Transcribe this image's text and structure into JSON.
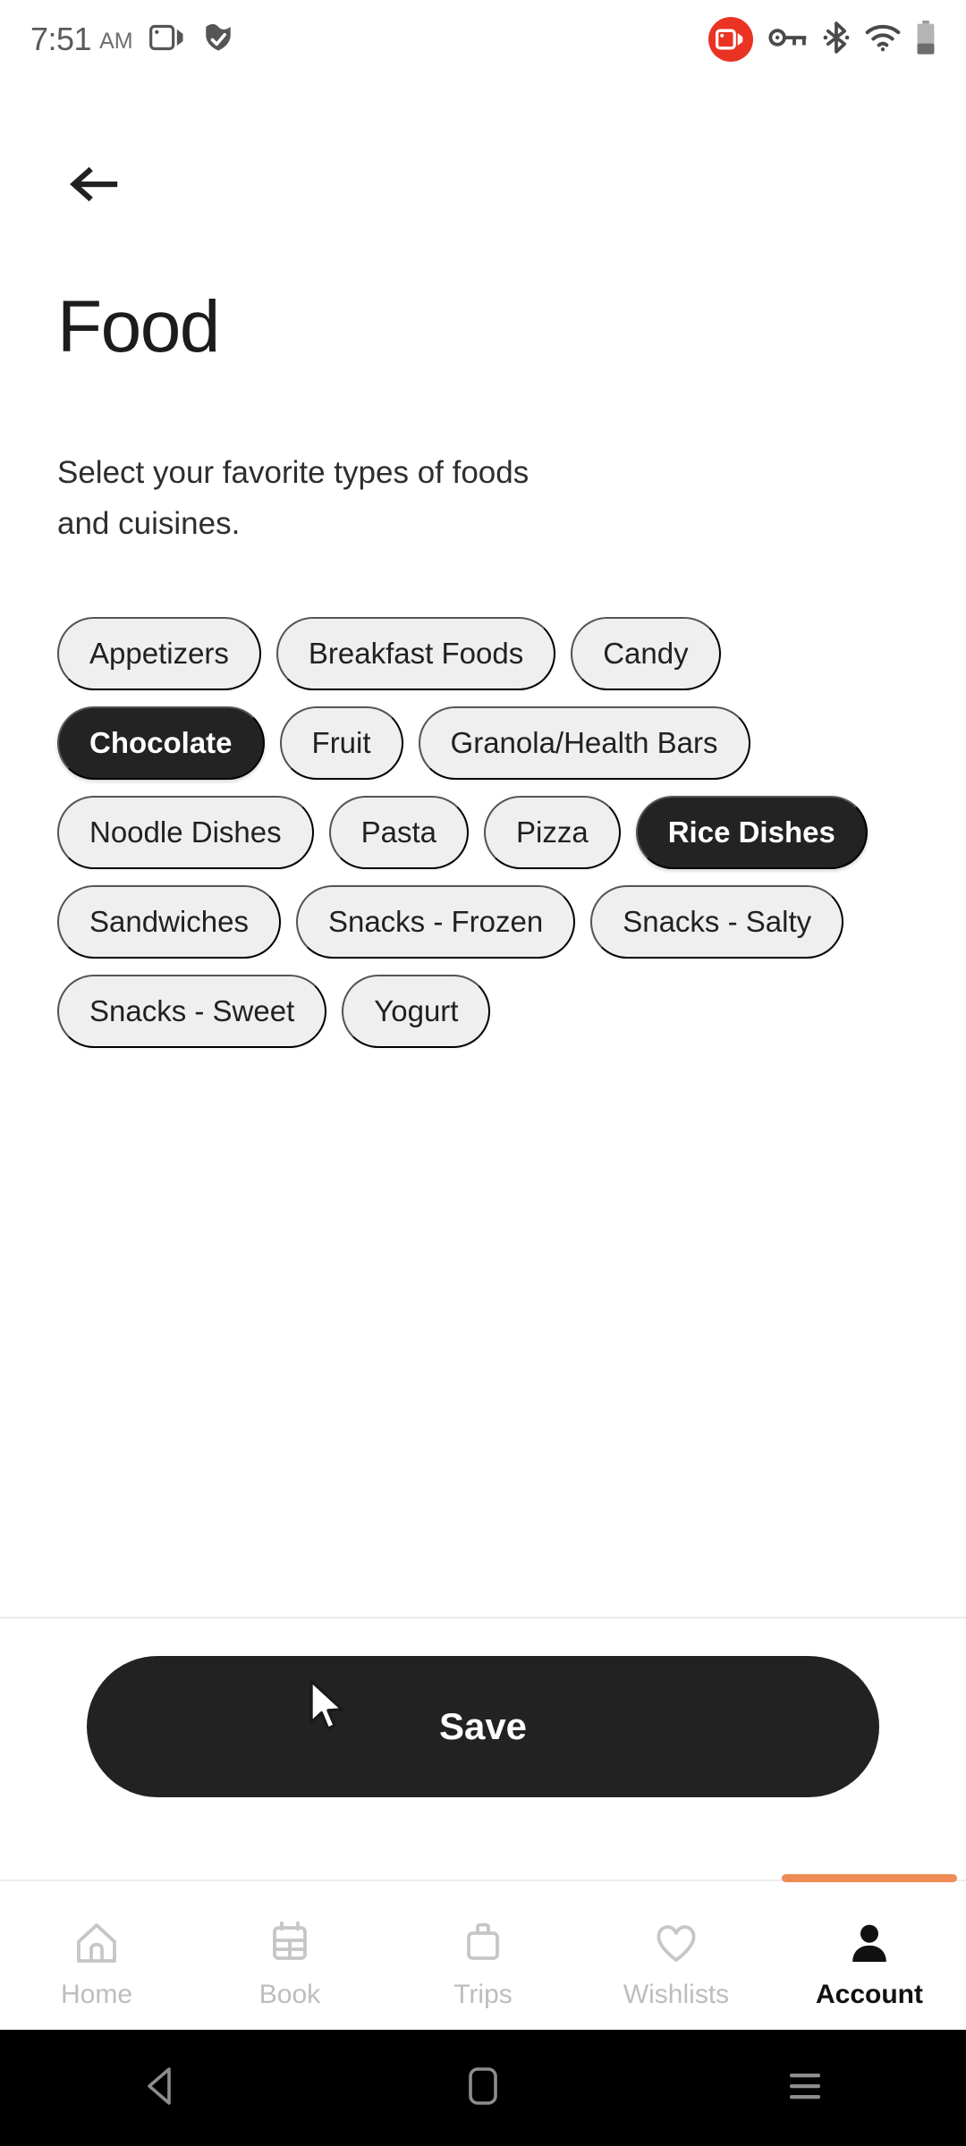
{
  "status_bar": {
    "time": "7:51",
    "ampm": "AM",
    "left_icons": [
      "screen-cast-icon",
      "vpn-shield-check-icon"
    ],
    "right_icons": [
      "screen-record-icon",
      "vpn-key-icon",
      "bluetooth-icon",
      "wifi-icon",
      "battery-icon"
    ],
    "record_badge_color": "#ea3323"
  },
  "header": {
    "back_label": "Back",
    "title": "Food",
    "description": "Select your favorite types of foods and cuisines."
  },
  "chips": [
    {
      "label": "Appetizers",
      "selected": false
    },
    {
      "label": "Breakfast Foods",
      "selected": false
    },
    {
      "label": "Candy",
      "selected": false
    },
    {
      "label": "Chocolate",
      "selected": true
    },
    {
      "label": "Fruit",
      "selected": false
    },
    {
      "label": "Granola/Health Bars",
      "selected": false
    },
    {
      "label": "Noodle Dishes",
      "selected": false
    },
    {
      "label": "Pasta",
      "selected": false
    },
    {
      "label": "Pizza",
      "selected": false
    },
    {
      "label": "Rice Dishes",
      "selected": true
    },
    {
      "label": "Sandwiches",
      "selected": false
    },
    {
      "label": "Snacks - Frozen",
      "selected": false
    },
    {
      "label": "Snacks - Salty",
      "selected": false
    },
    {
      "label": "Snacks - Sweet",
      "selected": false
    },
    {
      "label": "Yogurt",
      "selected": false
    }
  ],
  "footer": {
    "save_label": "Save",
    "save_bg": "#222222"
  },
  "tabbar": {
    "active_indicator_color": "#ef8b55",
    "items": [
      {
        "label": "Home",
        "icon": "home-icon",
        "active": false
      },
      {
        "label": "Book",
        "icon": "calendar-icon",
        "active": false
      },
      {
        "label": "Trips",
        "icon": "suitcase-icon",
        "active": false
      },
      {
        "label": "Wishlists",
        "icon": "heart-icon",
        "active": false
      },
      {
        "label": "Account",
        "icon": "person-icon",
        "active": true
      }
    ]
  },
  "system_nav": {
    "buttons": [
      "back-triangle-icon",
      "home-square-icon",
      "recents-lines-icon"
    ]
  }
}
